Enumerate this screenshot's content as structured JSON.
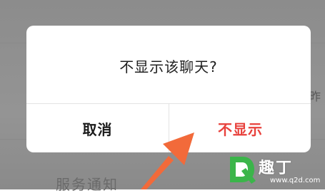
{
  "dialog": {
    "message": "不显示该聊天?",
    "cancel_label": "取消",
    "confirm_label": "不显示"
  },
  "background": {
    "right_fragment": "昨",
    "bottom_fragment": "服务通知"
  },
  "watermark": {
    "title": "趣丁",
    "url": "www.q2d.com",
    "logo_icon": "q2d-logo-icon"
  },
  "colors": {
    "confirm": "#e8413c",
    "arrow": "#f26a3a",
    "watermark_green": "#3bb54a"
  }
}
